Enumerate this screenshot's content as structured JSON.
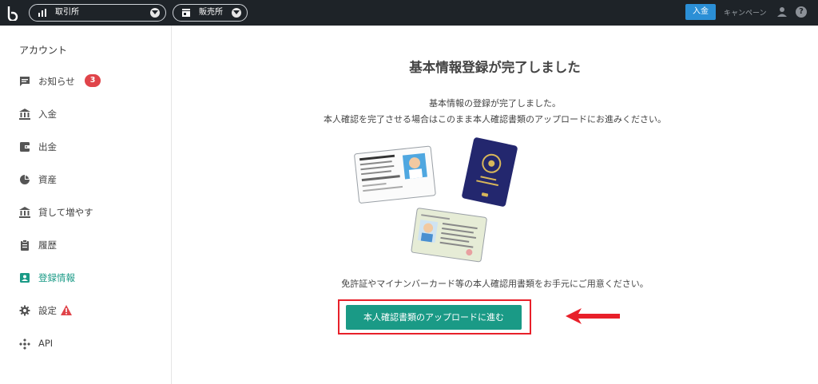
{
  "topbar": {
    "exchange_label": "取引所",
    "shop_label": "販売所",
    "deposit_button": "入金",
    "campaign_link": "キャンペーン",
    "help_icon": "?"
  },
  "sidebar": {
    "title": "アカウント",
    "items": [
      {
        "label": "お知らせ",
        "icon": "chat-icon",
        "badge": "3"
      },
      {
        "label": "入金",
        "icon": "bank-icon"
      },
      {
        "label": "出金",
        "icon": "wallet-icon"
      },
      {
        "label": "資産",
        "icon": "pie-chart-icon"
      },
      {
        "label": "貸して増やす",
        "icon": "bank-icon"
      },
      {
        "label": "履歴",
        "icon": "clipboard-icon"
      },
      {
        "label": "登録情報",
        "icon": "id-card-icon",
        "active": true
      },
      {
        "label": "設定",
        "icon": "gear-icon",
        "warning": true
      },
      {
        "label": "API",
        "icon": "api-icon"
      }
    ]
  },
  "main": {
    "title": "基本情報登録が完了しました",
    "line1": "基本情報の登録が完了しました。",
    "line2": "本人確認を完了させる場合はこのまま本人確認書類のアップロードにお進みください。",
    "note": "免許証やマイナンバーカード等の本人確認用書類をお手元にご用意ください。",
    "cta": "本人確認書類のアップロードに進む"
  },
  "colors": {
    "topbar": "#1e2328",
    "accent": "#1a9a86",
    "deposit": "#2b8fd6",
    "badge": "#e0444a",
    "highlight": "#e8202a"
  }
}
